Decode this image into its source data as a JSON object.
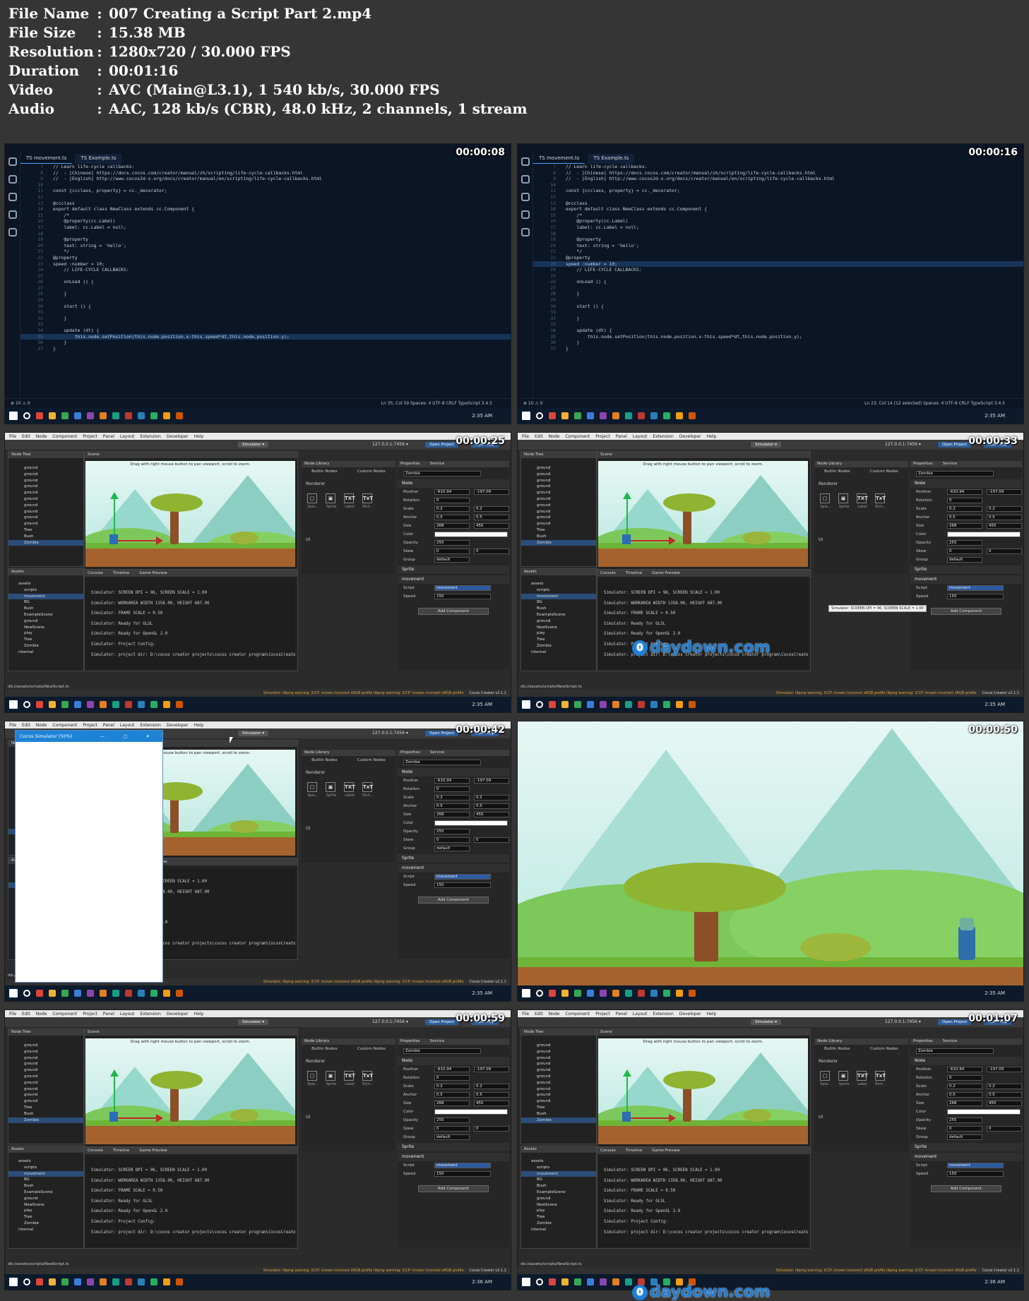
{
  "info": [
    {
      "key": "File Name",
      "value": "007 Creating a Script Part 2.mp4"
    },
    {
      "key": "File Size",
      "value": "15.38 MB"
    },
    {
      "key": "Resolution",
      "value": "1280x720 / 30.000 FPS"
    },
    {
      "key": "Duration",
      "value": "00:01:16"
    },
    {
      "key": "Video",
      "value": "AVC (Main@L3.1), 1 540 kb/s, 30.000 FPS"
    },
    {
      "key": "Audio",
      "value": "AAC, 128 kb/s (CBR), 48.0 kHz, 2 channels, 1 stream"
    }
  ],
  "separator": ":",
  "timestamps": [
    "00:00:08",
    "00:00:16",
    "00:00:25",
    "00:00:33",
    "00:00:42",
    "00:00:50",
    "00:00:59",
    "00:01:07"
  ],
  "vscode": {
    "tabs": [
      "TS movement.ts",
      "TS Example.ts"
    ],
    "code_lines": [
      {
        "n": "7",
        "t": "// Learn life-cycle callbacks:"
      },
      {
        "n": "8",
        "t": "//  - [Chinese] https://docs.cocos.com/creator/manual/zh/scripting/life-cycle-callbacks.html"
      },
      {
        "n": "9",
        "t": "//  - [English] http://www.cocos2d-x.org/docs/creator/manual/en/scripting/life-cycle-callbacks.html"
      },
      {
        "n": "10",
        "t": ""
      },
      {
        "n": "11",
        "t": "const {ccclass, property} = cc._decorator;"
      },
      {
        "n": "12",
        "t": ""
      },
      {
        "n": "13",
        "t": "@ccclass"
      },
      {
        "n": "14",
        "t": "export default class NewClass extends cc.Component {"
      },
      {
        "n": "15",
        "t": "    /*"
      },
      {
        "n": "16",
        "t": "    @property(cc.Label)"
      },
      {
        "n": "17",
        "t": "    label: cc.Label = null;"
      },
      {
        "n": "18",
        "t": ""
      },
      {
        "n": "19",
        "t": "    @property"
      },
      {
        "n": "20",
        "t": "    text: string = 'hello';"
      },
      {
        "n": "21",
        "t": "    */"
      },
      {
        "n": "22",
        "t": "@property"
      },
      {
        "n": "23",
        "t": "speed :number = 10;"
      },
      {
        "n": "24",
        "t": "    // LIFE-CYCLE CALLBACKS:"
      },
      {
        "n": "25",
        "t": ""
      },
      {
        "n": "26",
        "t": "    onLoad () {"
      },
      {
        "n": "27",
        "t": ""
      },
      {
        "n": "28",
        "t": "    }"
      },
      {
        "n": "29",
        "t": ""
      },
      {
        "n": "30",
        "t": "    start () {"
      },
      {
        "n": "31",
        "t": ""
      },
      {
        "n": "32",
        "t": "    }"
      },
      {
        "n": "33",
        "t": ""
      },
      {
        "n": "34",
        "t": "    update (dt) {"
      },
      {
        "n": "35",
        "t": "        this.node.setPosition(this.node.position.x-this.speed*dt,this.node.position.y);"
      },
      {
        "n": "36",
        "t": "    }"
      },
      {
        "n": "37",
        "t": "}"
      }
    ],
    "status_left": "⊗ 10 ⚠ 0",
    "status_right_1": "Ln 35, Col 59   Spaces: 4   UTF-8   CRLF   TypeScript   3.4.5",
    "status_right_2": "Ln 23, Col 14 (12 selected)   Spaces: 4   UTF-8   CRLF   TypeScript   3.4.5"
  },
  "cocos": {
    "menu": [
      "File",
      "Edit",
      "Node",
      "Component",
      "Project",
      "Panel",
      "Layout",
      "Extension",
      "Developer",
      "Help"
    ],
    "ip": "127.0.0.1:7456 ▾",
    "open_project": "Open Project",
    "open_app": "Open App",
    "simulator": "Simulator ▾",
    "node_tree_title": "Node Tree",
    "nodes": [
      "ground",
      "ground",
      "ground",
      "ground",
      "ground",
      "ground",
      "ground",
      "ground",
      "ground",
      "ground",
      "Tree",
      "Bush",
      "Zombie"
    ],
    "scene_title": "Scene",
    "scene_hint": "Drag with right mouse button to pan viewport, scroll to zoom.",
    "node_library_title": "Node Library",
    "builtin_nodes": "Builtin Nodes",
    "custom_nodes": "Custom Nodes",
    "renderer": "Renderer",
    "lib_items": [
      {
        "g": "▢",
        "l": "Spla..."
      },
      {
        "g": "▣",
        "l": "Sprite"
      },
      {
        "g": "TXT",
        "l": "Label"
      },
      {
        "g": "TxT",
        "l": "Rich..."
      }
    ],
    "ui_label": "UI",
    "properties_title": "Properties",
    "service_title": "Service",
    "selected_node": "Zombie",
    "node_section": "Node",
    "props": [
      {
        "label": "Position",
        "x": "-610.94",
        "y": "-197.09"
      },
      {
        "label": "Rotation",
        "x": "0",
        "y": ""
      },
      {
        "label": "Scale",
        "x": "0.2",
        "y": "0.2"
      },
      {
        "label": "Anchor",
        "x": "0.5",
        "y": "0.5"
      },
      {
        "label": "Size",
        "x": "268",
        "y": "455"
      },
      {
        "label": "Color",
        "x": "",
        "y": ""
      },
      {
        "label": "Opacity",
        "x": "255",
        "y": ""
      },
      {
        "label": "Skew",
        "x": "0",
        "y": "0"
      },
      {
        "label": "Group",
        "x": "default",
        "y": ""
      }
    ],
    "sprite_section": "Sprite",
    "movement_section": "movement",
    "script_label": "Script",
    "script_value": "movement",
    "speed_label": "Speed",
    "speed_value": "150",
    "add_component": "Add Component",
    "assets_title": "Assets",
    "assets": [
      "assets",
      "scripts",
      "movement",
      "BG",
      "Bush",
      "ExampleScene",
      "ground",
      "NewScene",
      "play",
      "Tree",
      "Zombie",
      "internal"
    ],
    "console_tabs": [
      "Console",
      "Timeline",
      "Game Preview"
    ],
    "console_lines": [
      "Simulator: SCREEN DPI = 96, SCREEN SCALE = 1.00",
      "Simulator: WORKAREA WIDTH 1358.00, HEIGHT 687.00",
      "Simulator: FRAME SCALE = 0.50",
      "Simulator: Ready for GLSL",
      "Simulator: Ready for OpenGL 2.0",
      "Simulator: Project Config:",
      "Simulator: project dir: D:\\cocos creator projects\\cocos creator program\\CocosCreator\\resources\\cocos2"
    ],
    "path": "db://assets/scripts/NewScript.ts",
    "status_warn": "Simulator: libpng warning: iCCP: known incorrect sRGB profile libpng warning: iCCP: known incorrect sRGB profile",
    "version": "Cocos Creator v2.1.1",
    "tooltip": "Simulator: SCREEN DPI = 96, SCREEN SCALE = 1.00",
    "sim_title": "Cocos Simulator (50%)"
  },
  "clocks": [
    "2:35 AM",
    "2:35 AM",
    "2:35 AM",
    "2:35 AM",
    "2:35 AM",
    "2:35 AM",
    "2:36 AM",
    "2:36 AM"
  ],
  "watermark": "daydown.com",
  "colors": {
    "accent": "#1e7fd6",
    "bg": "#353535"
  }
}
